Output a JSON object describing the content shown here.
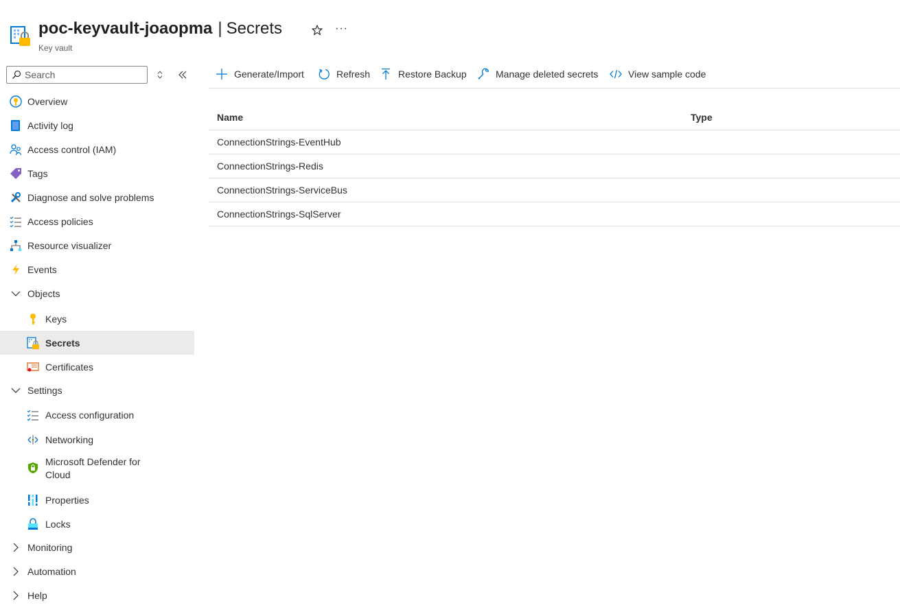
{
  "header": {
    "resource_name": "poc-keyvault-joaopma",
    "separator": "|",
    "blade_title": "Secrets",
    "subtitle": "Key vault",
    "more_label": "···",
    "icon": "key-vault-icon"
  },
  "sidebar": {
    "search_placeholder": "Search",
    "items": [
      {
        "label": "Overview",
        "icon": "overview-icon"
      },
      {
        "label": "Activity log",
        "icon": "activity-log-icon"
      },
      {
        "label": "Access control (IAM)",
        "icon": "access-control-icon"
      },
      {
        "label": "Tags",
        "icon": "tag-icon"
      },
      {
        "label": "Diagnose and solve problems",
        "icon": "wrench-icon"
      },
      {
        "label": "Access policies",
        "icon": "checklist-icon"
      },
      {
        "label": "Resource visualizer",
        "icon": "hierarchy-icon"
      },
      {
        "label": "Events",
        "icon": "lightning-icon"
      }
    ],
    "objects": {
      "label": "Objects",
      "items": [
        {
          "label": "Keys",
          "icon": "key-icon"
        },
        {
          "label": "Secrets",
          "icon": "secret-icon",
          "active": true
        },
        {
          "label": "Certificates",
          "icon": "certificate-icon"
        }
      ]
    },
    "settings": {
      "label": "Settings",
      "items": [
        {
          "label": "Access configuration",
          "icon": "checklist-icon"
        },
        {
          "label": "Networking",
          "icon": "networking-icon"
        },
        {
          "label": "Microsoft Defender for Cloud",
          "icon": "shield-icon"
        },
        {
          "label": "Properties",
          "icon": "properties-icon"
        },
        {
          "label": "Locks",
          "icon": "lock-icon"
        }
      ]
    },
    "monitoring_label": "Monitoring",
    "automation_label": "Automation",
    "help_label": "Help"
  },
  "toolbar": {
    "generate_import": "Generate/Import",
    "refresh": "Refresh",
    "restore_backup": "Restore Backup",
    "manage_deleted": "Manage deleted secrets",
    "view_sample": "View sample code"
  },
  "table": {
    "columns": [
      "Name",
      "Type"
    ],
    "rows": [
      {
        "name": "ConnectionStrings-EventHub",
        "type": ""
      },
      {
        "name": "ConnectionStrings-Redis",
        "type": ""
      },
      {
        "name": "ConnectionStrings-ServiceBus",
        "type": ""
      },
      {
        "name": "ConnectionStrings-SqlServer",
        "type": ""
      }
    ]
  },
  "colors": {
    "accent": "#0078d4",
    "active_bg": "#edebe9",
    "border": "#e1dfdd",
    "key_yellow": "#ffb900"
  }
}
